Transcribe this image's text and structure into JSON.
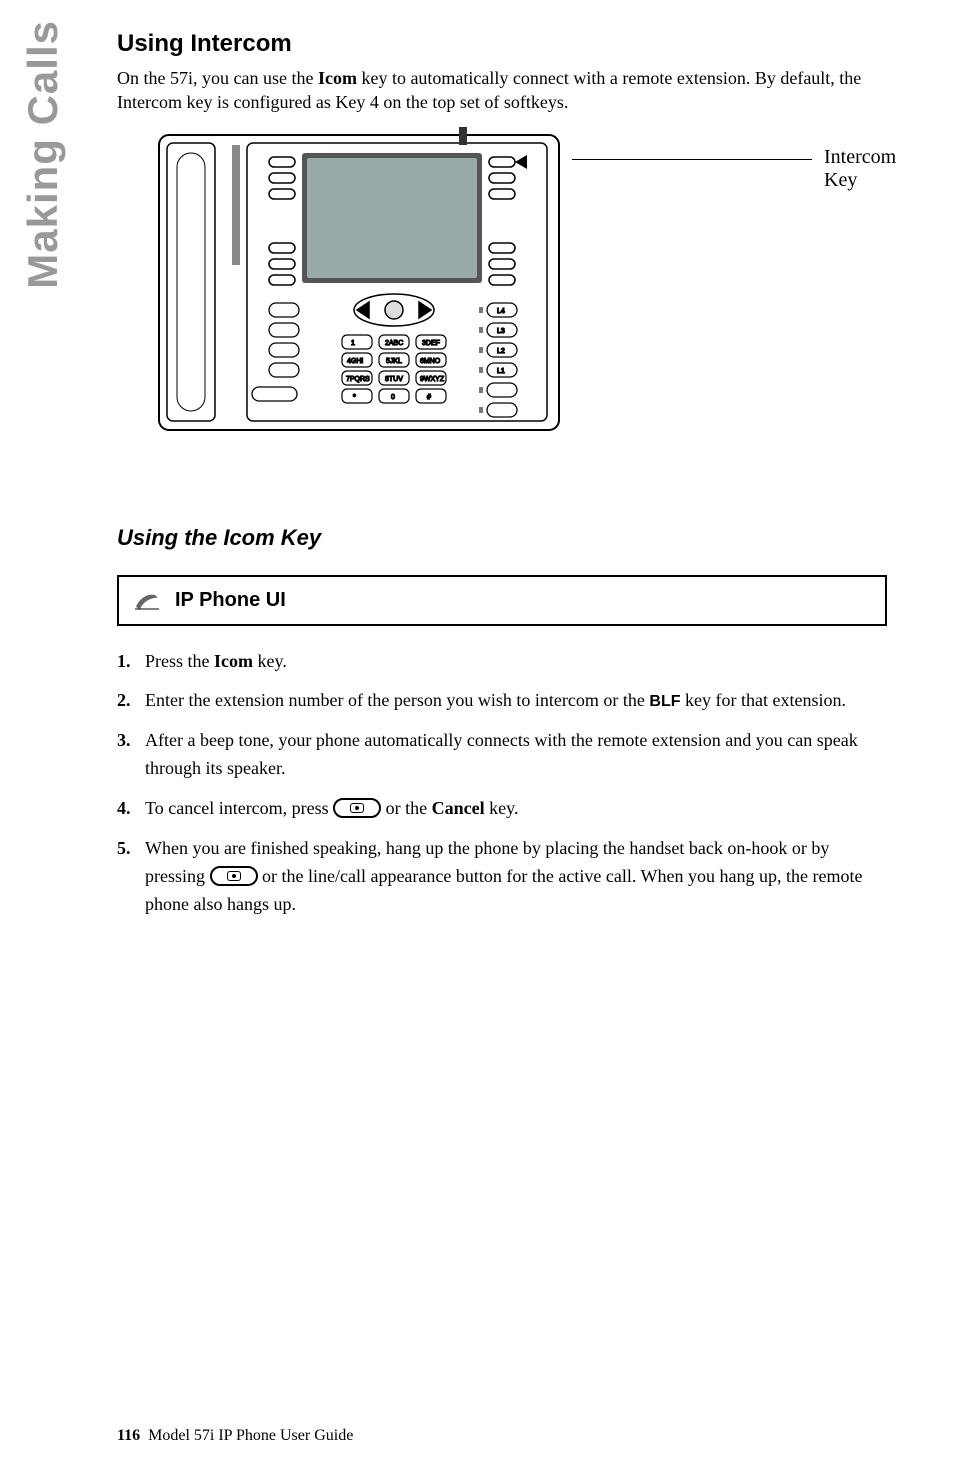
{
  "sidebar": {
    "label": "Making Calls"
  },
  "section": {
    "heading": "Using Intercom",
    "intro_pre": "On the 57i, you can use the ",
    "intro_key": "Icom",
    "intro_post": " key to automatically connect with a remote extension. By default, the Intercom key is configured as Key 4 on the top set of softkeys.",
    "callout_line1": "Intercom",
    "callout_line2": "Key"
  },
  "subsection": {
    "heading": "Using the Icom Key",
    "ui_label": "IP Phone UI"
  },
  "steps": {
    "s1_pre": "Press the ",
    "s1_key": "Icom",
    "s1_post": " key.",
    "s2_pre": "Enter the extension number of the person you wish to intercom or the ",
    "s2_key": "BLF",
    "s2_post": " key for that extension.",
    "s3": "After a beep tone, your phone automatically connects with the remote extension and you can speak through its speaker.",
    "s4_pre": "To cancel intercom, press ",
    "s4_mid": " or the ",
    "s4_key": "Cancel",
    "s4_post": " key.",
    "s5_pre": "When you are finished speaking, hang up the phone by placing the handset back on-hook or by pressing ",
    "s5_mid": " or the line/call appearance button for the active call. ",
    "s5_post": "When you hang up, the remote phone also hangs up."
  },
  "footer": {
    "page": "116",
    "title": "Model 57i IP Phone User Guide"
  }
}
